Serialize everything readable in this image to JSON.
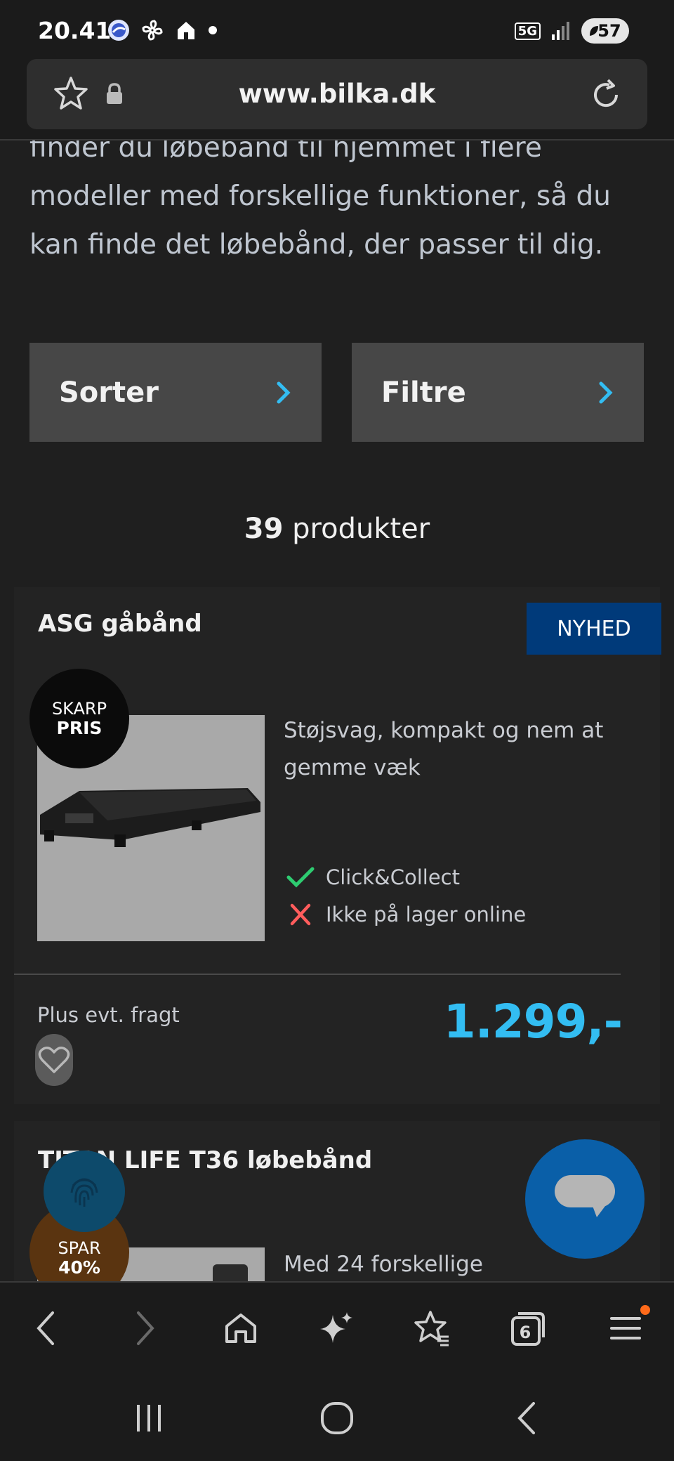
{
  "status_bar": {
    "time": "20.41",
    "network": "5G",
    "battery": "57"
  },
  "url_bar": {
    "url": "www.bilka.dk"
  },
  "intro_text": {
    "line1": "finder du løbebånd til hjemmet i flere",
    "line2": "modeller med forskellige funktioner, så du",
    "line3": "kan finde det løbebånd, der passer til dig."
  },
  "controls": {
    "sort_label": "Sorter",
    "filter_label": "Filtre"
  },
  "results": {
    "count": "39",
    "suffix": " produkter"
  },
  "products": [
    {
      "title": "ASG gåbånd",
      "badge": "NYHED",
      "sale_line1": "SKARP",
      "sale_line2": "PRIS",
      "description": "Støjsvag, kompakt og nem at gemme væk",
      "availability": [
        {
          "text": "Click&Collect",
          "status": "available",
          "color": "#2ecc71"
        },
        {
          "text": "Ikke på lager online",
          "status": "unavailable",
          "color": "#ff5c5c"
        }
      ],
      "shipping": "Plus evt. fragt",
      "price": "1.299,-",
      "price_color": "#33bdf2"
    },
    {
      "title": "TITAN LIFE T36 løbebånd",
      "sale_line1": "SPAR",
      "sale_line2": "40%",
      "description": "Med 24 forskellige"
    }
  ],
  "toolbar": {
    "tabs_count": "6",
    "icons": [
      "back-icon",
      "forward-icon",
      "home-icon",
      "sparkle-icon",
      "bookmark-star-icon",
      "tabs-icon",
      "menu-icon"
    ]
  },
  "colors": {
    "background": "#1f1f1f",
    "accent": "#33bdf2",
    "badge": "#003a7a",
    "chat": "#0a5fa8"
  }
}
